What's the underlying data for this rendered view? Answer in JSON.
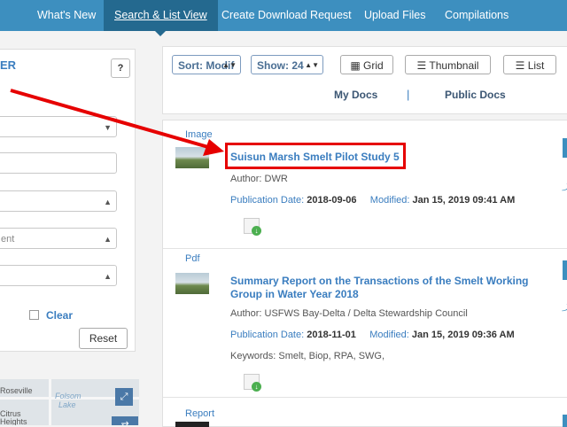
{
  "nav": {
    "items": [
      "What's New",
      "Search & List View",
      "Create Download Request",
      "Upload Files",
      "Compilations"
    ]
  },
  "left_panel": {
    "title_fragment": "ER",
    "help_label": "?",
    "field_value_fragment": "ent",
    "clear_label": "Clear",
    "reset_label": "Reset"
  },
  "map": {
    "places": [
      "Roseville",
      "Folsom",
      "Lake",
      "Citrus",
      "Heights"
    ],
    "expand_icon": "expand-icon",
    "layers_icon": "swap-icon"
  },
  "toolbar": {
    "sort_label": "Sort: Modif",
    "show_label": "Show: 24",
    "views": [
      "Grid",
      "Thumbnail",
      "List"
    ],
    "tabs": [
      "My Docs",
      "Public Docs"
    ],
    "tab_separator": "|"
  },
  "results": [
    {
      "type": "Image",
      "title": "Suisun Marsh Smelt Pilot Study 5",
      "author_label": "Author:",
      "author": "DWR",
      "pub_label": "Publication Date:",
      "pub_date": "2018-09-06",
      "mod_label": "Modified:",
      "modified": "Jan 15, 2019 09:41 AM"
    },
    {
      "type": "Pdf",
      "title": "Summary Report on the Transactions of the Smelt Working Group in Water Year 2018",
      "author_label": "Author:",
      "author": "USFWS Bay-Delta / Delta Stewardship Council",
      "pub_label": "Publication Date:",
      "pub_date": "2018-11-01",
      "mod_label": "Modified:",
      "modified": "Jan 15, 2019 09:36 AM",
      "keywords_label": "Keywords:",
      "keywords": "Smelt, Biop, RPA, SWG,"
    },
    {
      "type": "Report"
    }
  ],
  "colors": {
    "nav_bg": "#3d8fbf",
    "nav_active": "#24698f",
    "link": "#3a7dbf",
    "annotation": "#e60000"
  }
}
